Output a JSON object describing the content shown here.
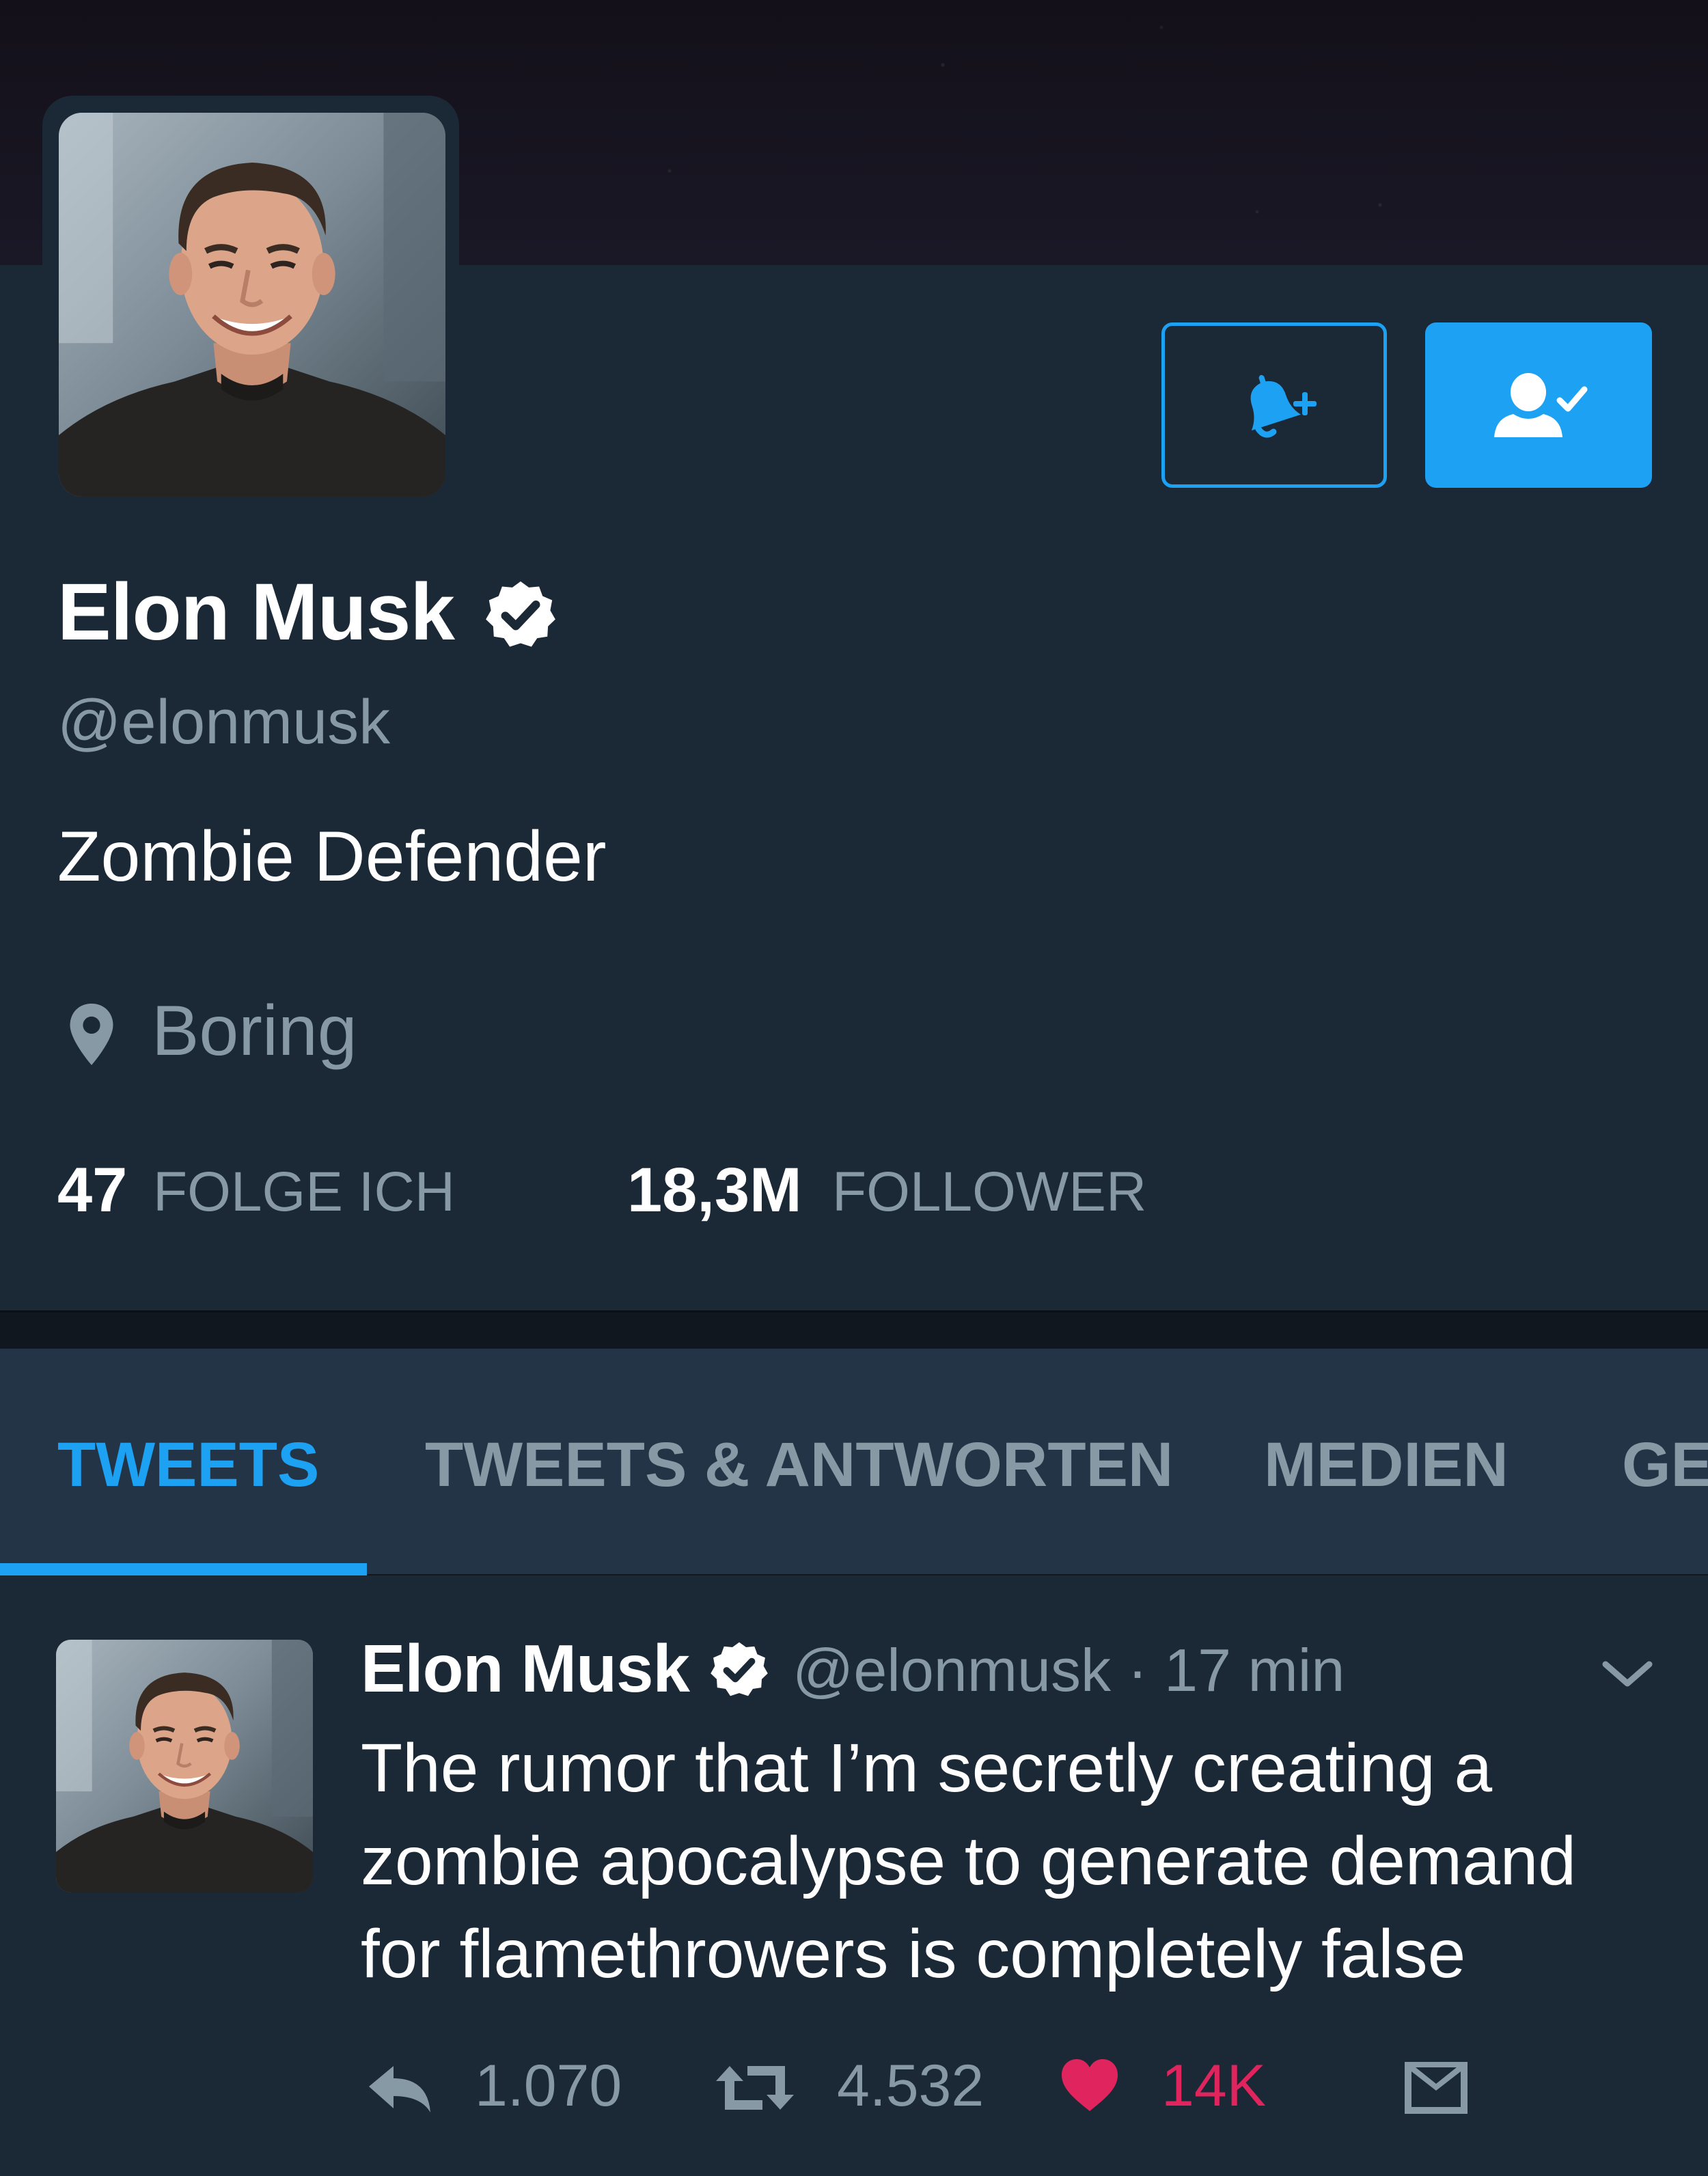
{
  "profile": {
    "name": "Elon Musk",
    "handle": "@elonmusk",
    "bio": "Zombie Defender",
    "location": "Boring",
    "following_count": "47",
    "following_label": "FOLGE ICH",
    "followers_count": "18,3M",
    "followers_label": "FOLLOWER"
  },
  "tabs": [
    {
      "label": "TWEETS",
      "active": true
    },
    {
      "label": "TWEETS & ANTWORTEN"
    },
    {
      "label": "MEDIEN"
    },
    {
      "label": "GE"
    }
  ],
  "tweet": {
    "name": "Elon Musk",
    "handle": "@elonmusk",
    "time": "· 17 min",
    "text": "The rumor that I’m secretly creating a zombie apocalypse to generate demand for flamethrowers is completely false",
    "replies": "1.070",
    "retweets": "4.532",
    "likes": "14K"
  },
  "icons": {
    "notify": "bell-plus-icon",
    "following": "user-check-icon",
    "verified": "verified-badge-icon",
    "location": "map-pin-icon",
    "chevron": "chevron-down-icon",
    "reply": "reply-icon",
    "retweet": "retweet-icon",
    "like": "heart-icon",
    "dm": "envelope-icon"
  },
  "colors": {
    "accent": "#1da1f2",
    "background": "#1b2836",
    "tabs_background": "#243447",
    "muted_text": "#8899a6",
    "like": "#e0245e"
  }
}
